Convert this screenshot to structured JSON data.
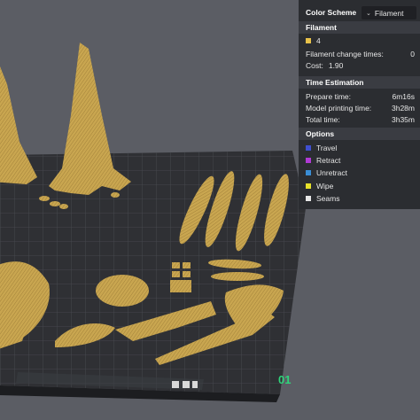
{
  "panel": {
    "color_scheme_label": "Color Scheme",
    "color_scheme_value": "Filament",
    "filament_header": "Filament",
    "filament_item": {
      "label": "4",
      "color": "#e8c24a"
    },
    "filament_change_label": "Filament change times:",
    "filament_change_value": "0",
    "cost_label": "Cost:",
    "cost_value": "1.90",
    "time_header": "Time Estimation",
    "prepare_label": "Prepare time:",
    "prepare_value": "6m16s",
    "model_label": "Model printing time:",
    "model_value": "3h28m",
    "total_label": "Total time:",
    "total_value": "3h35m",
    "options_header": "Options",
    "options": [
      {
        "label": "Travel",
        "color": "#3f4fd0"
      },
      {
        "label": "Retract",
        "color": "#b03ad6"
      },
      {
        "label": "Unretract",
        "color": "#3a8ed6"
      },
      {
        "label": "Wipe",
        "color": "#e7e22a"
      },
      {
        "label": "Seams",
        "color": "#e8e8e8"
      }
    ]
  },
  "plate": {
    "label": "01",
    "label_color": "#2fd37a"
  },
  "colors": {
    "model": "#c9a650",
    "plate": "#2f3034",
    "background": "#5b5d64"
  }
}
